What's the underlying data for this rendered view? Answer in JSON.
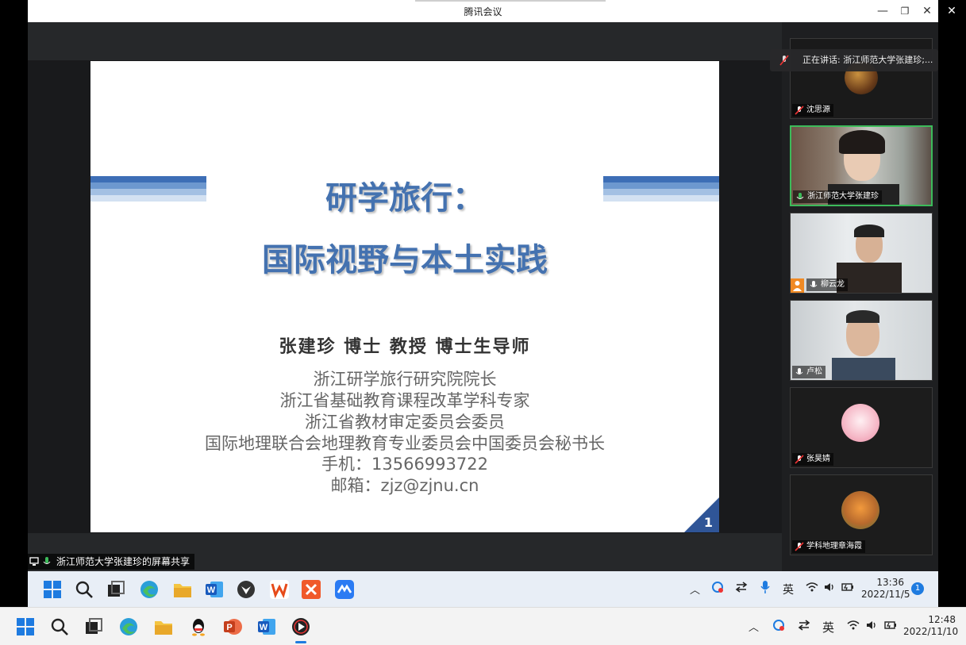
{
  "window": {
    "title": "腾讯会议",
    "minimize_icon": "—",
    "restore_icon": "❐",
    "close_icon": "✕",
    "outer_close_icon": "✕"
  },
  "slide": {
    "title_line1": "研学旅行：",
    "title_line2": "国际视野与本土实践",
    "author": "张建珍 博士 教授 博士生导师",
    "info_lines": [
      "浙江研学旅行研究院院长",
      "浙江省基础教育课程改革学科专家",
      "浙江省教材审定委员会委员",
      "国际地理联合会地理教育专业委员会中国委员会秘书长",
      "手机：13566993722",
      "邮箱：zjz@zjnu.cn"
    ],
    "page_number": "1",
    "stripe_colors": [
      "#3d6eb6",
      "#6d98cf",
      "#a3c0e3",
      "#d3e1f2"
    ]
  },
  "speaking_banner": {
    "text": "正在讲话: 浙江师范大学张建珍;..."
  },
  "participants": [
    {
      "name": "沈思源",
      "mic": "muted"
    },
    {
      "name": "浙江师范大学张建珍",
      "mic": "speaking"
    },
    {
      "name": "柳云龙",
      "mic": "on",
      "host": true
    },
    {
      "name": "卢松",
      "mic": "on"
    },
    {
      "name": "张昊婧",
      "mic": "muted"
    },
    {
      "name": "学科地理章海霞",
      "mic": "muted"
    }
  ],
  "screen_share_label": "浙江师范大学张建珍的屏幕共享",
  "inner_taskbar": {
    "ime": "英",
    "time": "13:36",
    "date": "2022/11/5",
    "notification_count": "1"
  },
  "outer_taskbar": {
    "ime": "英",
    "time": "12:48",
    "date": "2022/11/10"
  },
  "colors": {
    "speaking_border": "#3cbb5a",
    "slide_title": "#4472b0",
    "page_corner": "#2f5597"
  }
}
